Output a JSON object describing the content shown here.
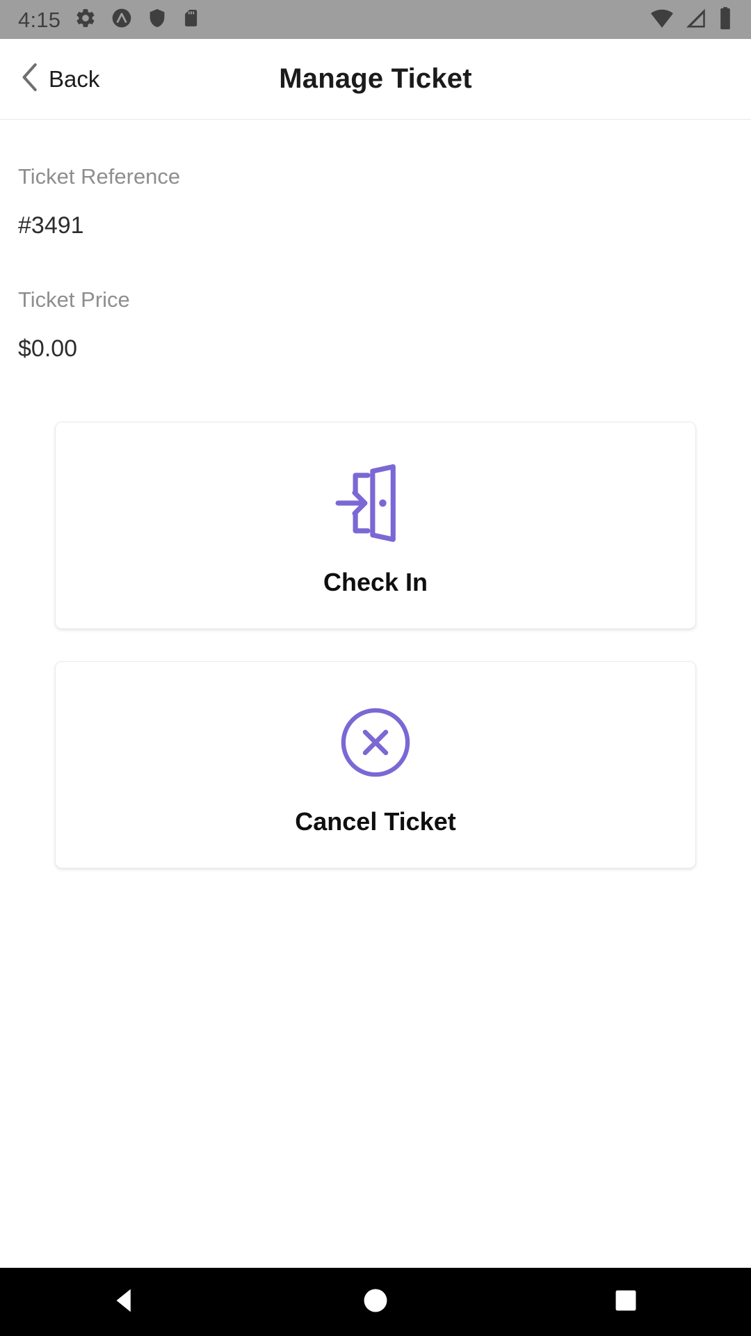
{
  "status_bar": {
    "time": "4:15",
    "left_icons": [
      "gear-icon",
      "vpn-badge-icon",
      "shield-icon",
      "sd-card-icon"
    ],
    "right_icons": [
      "wifi-icon",
      "cellular-signal-icon",
      "battery-icon"
    ],
    "background_color": "#9e9e9e",
    "icon_color": "#3f3f3f"
  },
  "appbar": {
    "back_label": "Back",
    "back_icon": "chevron-left-icon",
    "title": "Manage Ticket"
  },
  "details": {
    "reference": {
      "label": "Ticket Reference",
      "value": "#3491"
    },
    "price": {
      "label": "Ticket Price",
      "value": "$0.00"
    }
  },
  "actions": [
    {
      "label": "Check In",
      "icon": "door-enter-icon"
    },
    {
      "label": "Cancel Ticket",
      "icon": "circle-x-icon"
    }
  ],
  "navbar": {
    "back": "nav-back-triangle-icon",
    "home": "nav-home-circle-icon",
    "recents": "nav-recents-square-icon",
    "background_color": "#000000",
    "icon_color": "#ffffff"
  },
  "theme": {
    "accent": "#7B68D4",
    "label_gray": "#8e8e8e",
    "value_dark": "#2d2d2d",
    "card_border": "#eaeaea",
    "page_background": "#ffffff"
  }
}
